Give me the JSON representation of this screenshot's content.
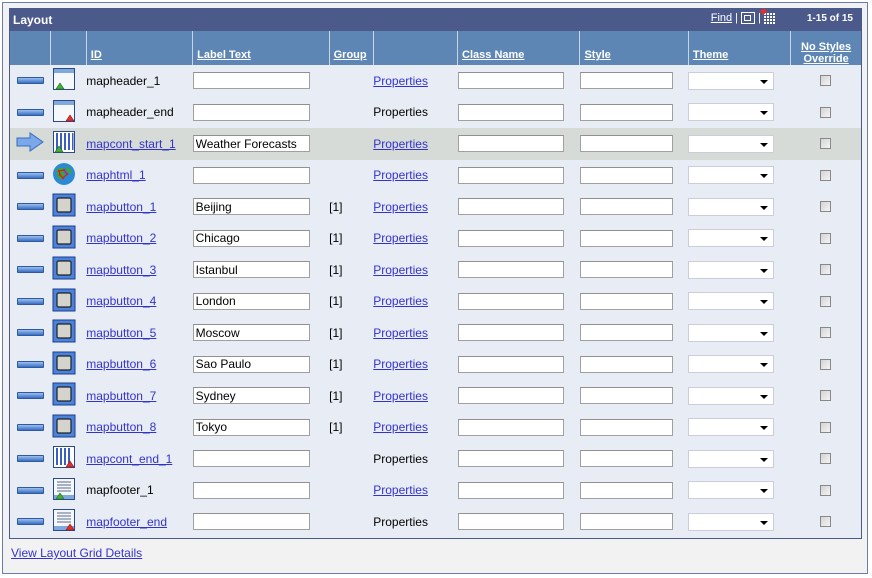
{
  "grid": {
    "title": "Layout",
    "nav": {
      "find_label": "Find",
      "separator": "|",
      "count": "1-15 of 15"
    },
    "columns": [
      "ID",
      "Label Text",
      "Group",
      "Class Name",
      "Style",
      "Theme",
      "No Styles Override"
    ],
    "rows": [
      {
        "move": "bar",
        "icon": "header-start-icon",
        "id": "mapheader_1",
        "id_link": false,
        "label": "",
        "group": "",
        "properties": "Properties",
        "props_link": true,
        "selected": false
      },
      {
        "move": "bar",
        "icon": "header-end-icon",
        "id": "mapheader_end",
        "id_link": false,
        "label": "",
        "group": "",
        "properties": "Properties",
        "props_link": false,
        "selected": false
      },
      {
        "move": "arrow",
        "icon": "container-start-icon",
        "id": "mapcont_start_1",
        "id_link": true,
        "label": "Weather Forecasts",
        "group": "",
        "properties": "Properties",
        "props_link": true,
        "selected": true
      },
      {
        "move": "bar",
        "icon": "html-globe-icon",
        "id": "maphtml_1",
        "id_link": true,
        "label": "",
        "group": "",
        "properties": "Properties",
        "props_link": true,
        "selected": false
      },
      {
        "move": "bar",
        "icon": "button-icon",
        "id": "mapbutton_1",
        "id_link": true,
        "label": "Beijing",
        "group": "[1]",
        "properties": "Properties",
        "props_link": true,
        "selected": false
      },
      {
        "move": "bar",
        "icon": "button-icon",
        "id": "mapbutton_2",
        "id_link": true,
        "label": "Chicago",
        "group": "[1]",
        "properties": "Properties",
        "props_link": true,
        "selected": false
      },
      {
        "move": "bar",
        "icon": "button-icon",
        "id": "mapbutton_3",
        "id_link": true,
        "label": "Istanbul",
        "group": "[1]",
        "properties": "Properties",
        "props_link": true,
        "selected": false
      },
      {
        "move": "bar",
        "icon": "button-icon",
        "id": "mapbutton_4",
        "id_link": true,
        "label": "London",
        "group": "[1]",
        "properties": "Properties",
        "props_link": true,
        "selected": false
      },
      {
        "move": "bar",
        "icon": "button-icon",
        "id": "mapbutton_5",
        "id_link": true,
        "label": "Moscow",
        "group": "[1]",
        "properties": "Properties",
        "props_link": true,
        "selected": false
      },
      {
        "move": "bar",
        "icon": "button-icon",
        "id": "mapbutton_6",
        "id_link": true,
        "label": "Sao Paulo",
        "group": "[1]",
        "properties": "Properties",
        "props_link": true,
        "selected": false
      },
      {
        "move": "bar",
        "icon": "button-icon",
        "id": "mapbutton_7",
        "id_link": true,
        "label": "Sydney",
        "group": "[1]",
        "properties": "Properties",
        "props_link": true,
        "selected": false
      },
      {
        "move": "bar",
        "icon": "button-icon",
        "id": "mapbutton_8",
        "id_link": true,
        "label": "Tokyo",
        "group": "[1]",
        "properties": "Properties",
        "props_link": true,
        "selected": false
      },
      {
        "move": "bar",
        "icon": "container-end-icon",
        "id": "mapcont_end_1",
        "id_link": true,
        "label": "",
        "group": "",
        "properties": "Properties",
        "props_link": false,
        "selected": false
      },
      {
        "move": "bar",
        "icon": "footer-start-icon",
        "id": "mapfooter_1",
        "id_link": false,
        "label": "",
        "group": "",
        "properties": "Properties",
        "props_link": true,
        "selected": false
      },
      {
        "move": "bar",
        "icon": "footer-end-icon",
        "id": "mapfooter_end",
        "id_link": true,
        "label": "",
        "group": "",
        "properties": "Properties",
        "props_link": false,
        "selected": false
      }
    ]
  },
  "footer": {
    "view_details_link": "View Layout Grid Details"
  },
  "colors": {
    "title_bar": "#4b5a8b",
    "header_row": "#5d86b4",
    "row_bg": "#e8ecf4",
    "selected_row": "#d6dbd8",
    "link": "#3333cc"
  }
}
